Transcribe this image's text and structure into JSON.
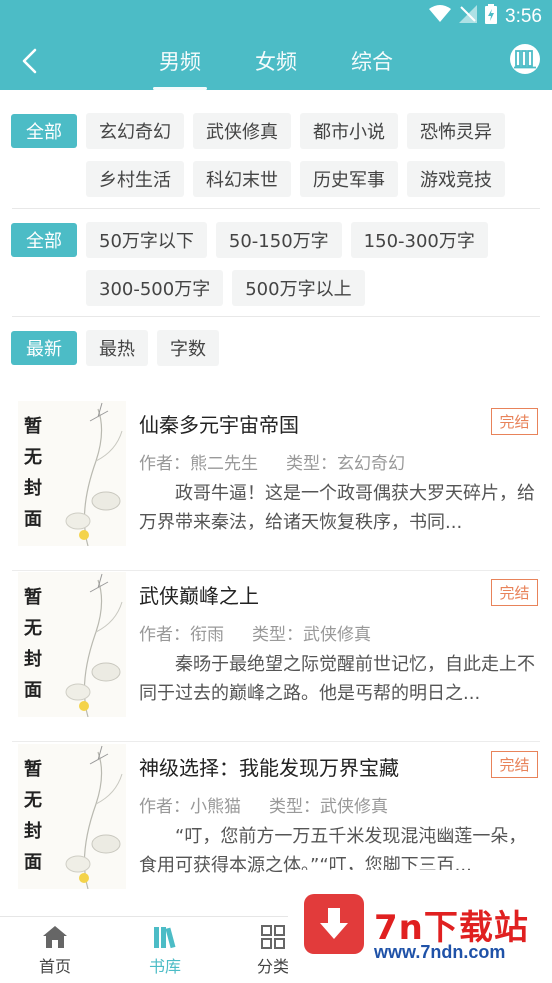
{
  "status_bar": {
    "time": "3:56"
  },
  "header": {
    "tabs": [
      {
        "label": "男频",
        "active": true
      },
      {
        "label": "女频",
        "active": false
      },
      {
        "label": "综合",
        "active": false
      }
    ]
  },
  "filters": {
    "genre": {
      "all_label": "全部",
      "chips": [
        "玄幻奇幻",
        "武侠修真",
        "都市小说",
        "恐怖灵异",
        "乡村生活",
        "科幻末世",
        "历史军事",
        "游戏竞技"
      ]
    },
    "length": {
      "all_label": "全部",
      "chips": [
        "50万字以下",
        "50-150万字",
        "150-300万字",
        "300-500万字",
        "500万字以上"
      ]
    },
    "sort": {
      "active_label": "最新",
      "chips": [
        "最热",
        "字数"
      ]
    }
  },
  "books": [
    {
      "cover_text": "暂无封面",
      "title": "仙秦多元宇宙帝国",
      "status": "完结",
      "author": "作者：熊二先生",
      "type": "类型：玄幻奇幻",
      "desc": "政哥牛逼！这是一个政哥偶获大罗天碎片，给万界带来秦法，给诸天恢复秩序，书同..."
    },
    {
      "cover_text": "暂无封面",
      "title": "武侠巅峰之上",
      "status": "完结",
      "author": "作者：衔雨",
      "type": "类型：武侠修真",
      "desc": "秦旸于最绝望之际觉醒前世记忆，自此走上不同于过去的巅峰之路。他是丐帮的明日之..."
    },
    {
      "cover_text": "暂无封面",
      "title": "神级选择：我能发现万界宝藏",
      "status": "完结",
      "author": "作者：小熊猫",
      "type": "类型：武侠修真",
      "desc": "“叮，您前方一万五千米发现混沌幽莲一朵，食用可获得本源之体。”“叮，您脚下三百..."
    }
  ],
  "bottom_nav": {
    "items": [
      {
        "label": "首页",
        "icon": "home-icon",
        "active": false
      },
      {
        "label": "书库",
        "icon": "books-icon",
        "active": true
      },
      {
        "label": "分类",
        "icon": "grid-icon",
        "active": false
      }
    ]
  },
  "watermark": {
    "title": "7n下载站",
    "url": "www.7ndn.com"
  },
  "colors": {
    "accent": "#4cbcc6",
    "status_border": "#e8835a",
    "watermark_red": "#e02020",
    "watermark_blue": "#1f52a8"
  }
}
